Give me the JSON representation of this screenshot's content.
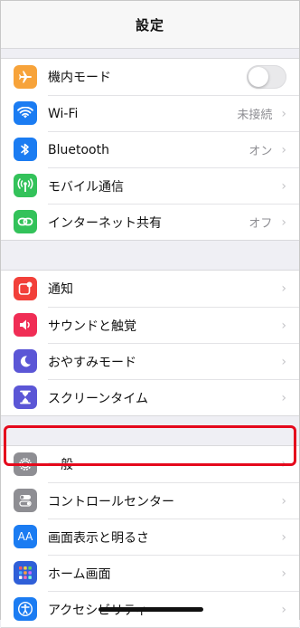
{
  "header": {
    "title": "設定"
  },
  "group1": [
    {
      "id": "airplane",
      "label": "機内モード",
      "icon_color": "#f7a33a",
      "icon_name": "airplane-icon",
      "toggle": false
    },
    {
      "id": "wifi",
      "label": "Wi-Fi",
      "value": "未接続",
      "icon_color": "#1b7cf2",
      "icon_name": "wifi-icon"
    },
    {
      "id": "bluetooth",
      "label": "Bluetooth",
      "value": "オン",
      "icon_color": "#1b7cf2",
      "icon_name": "bluetooth-icon"
    },
    {
      "id": "cellular",
      "label": "モバイル通信",
      "icon_color": "#33c25a",
      "icon_name": "antenna-icon"
    },
    {
      "id": "hotspot",
      "label": "インターネット共有",
      "value": "オフ",
      "icon_color": "#33c25a",
      "icon_name": "link-icon"
    }
  ],
  "group2": [
    {
      "id": "notifications",
      "label": "通知",
      "icon_color": "#f2403a",
      "icon_name": "notification-icon"
    },
    {
      "id": "sounds",
      "label": "サウンドと触覚",
      "icon_color": "#f02d55",
      "icon_name": "speaker-icon"
    },
    {
      "id": "dnd",
      "label": "おやすみモード",
      "icon_color": "#5b56d6",
      "icon_name": "moon-icon"
    },
    {
      "id": "screentime",
      "label": "スクリーンタイム",
      "icon_color": "#5b56d6",
      "icon_name": "hourglass-icon"
    }
  ],
  "group3": [
    {
      "id": "general",
      "label": "一般",
      "icon_color": "#8e8e93",
      "icon_name": "gear-icon"
    },
    {
      "id": "control",
      "label": "コントロールセンター",
      "icon_color": "#8e8e93",
      "icon_name": "switches-icon"
    },
    {
      "id": "display",
      "label": "画面表示と明るさ",
      "icon_color": "#1b7cf2",
      "icon_name": "text-size-icon",
      "icon_text": "AA"
    },
    {
      "id": "home",
      "label": "ホーム画面",
      "icon_color": "#2f5fd8",
      "icon_name": "app-grid-icon"
    },
    {
      "id": "accessibility",
      "label": "アクセシビリティ",
      "icon_color": "#1b7cf2",
      "icon_name": "accessibility-icon"
    }
  ],
  "chevron": "›"
}
